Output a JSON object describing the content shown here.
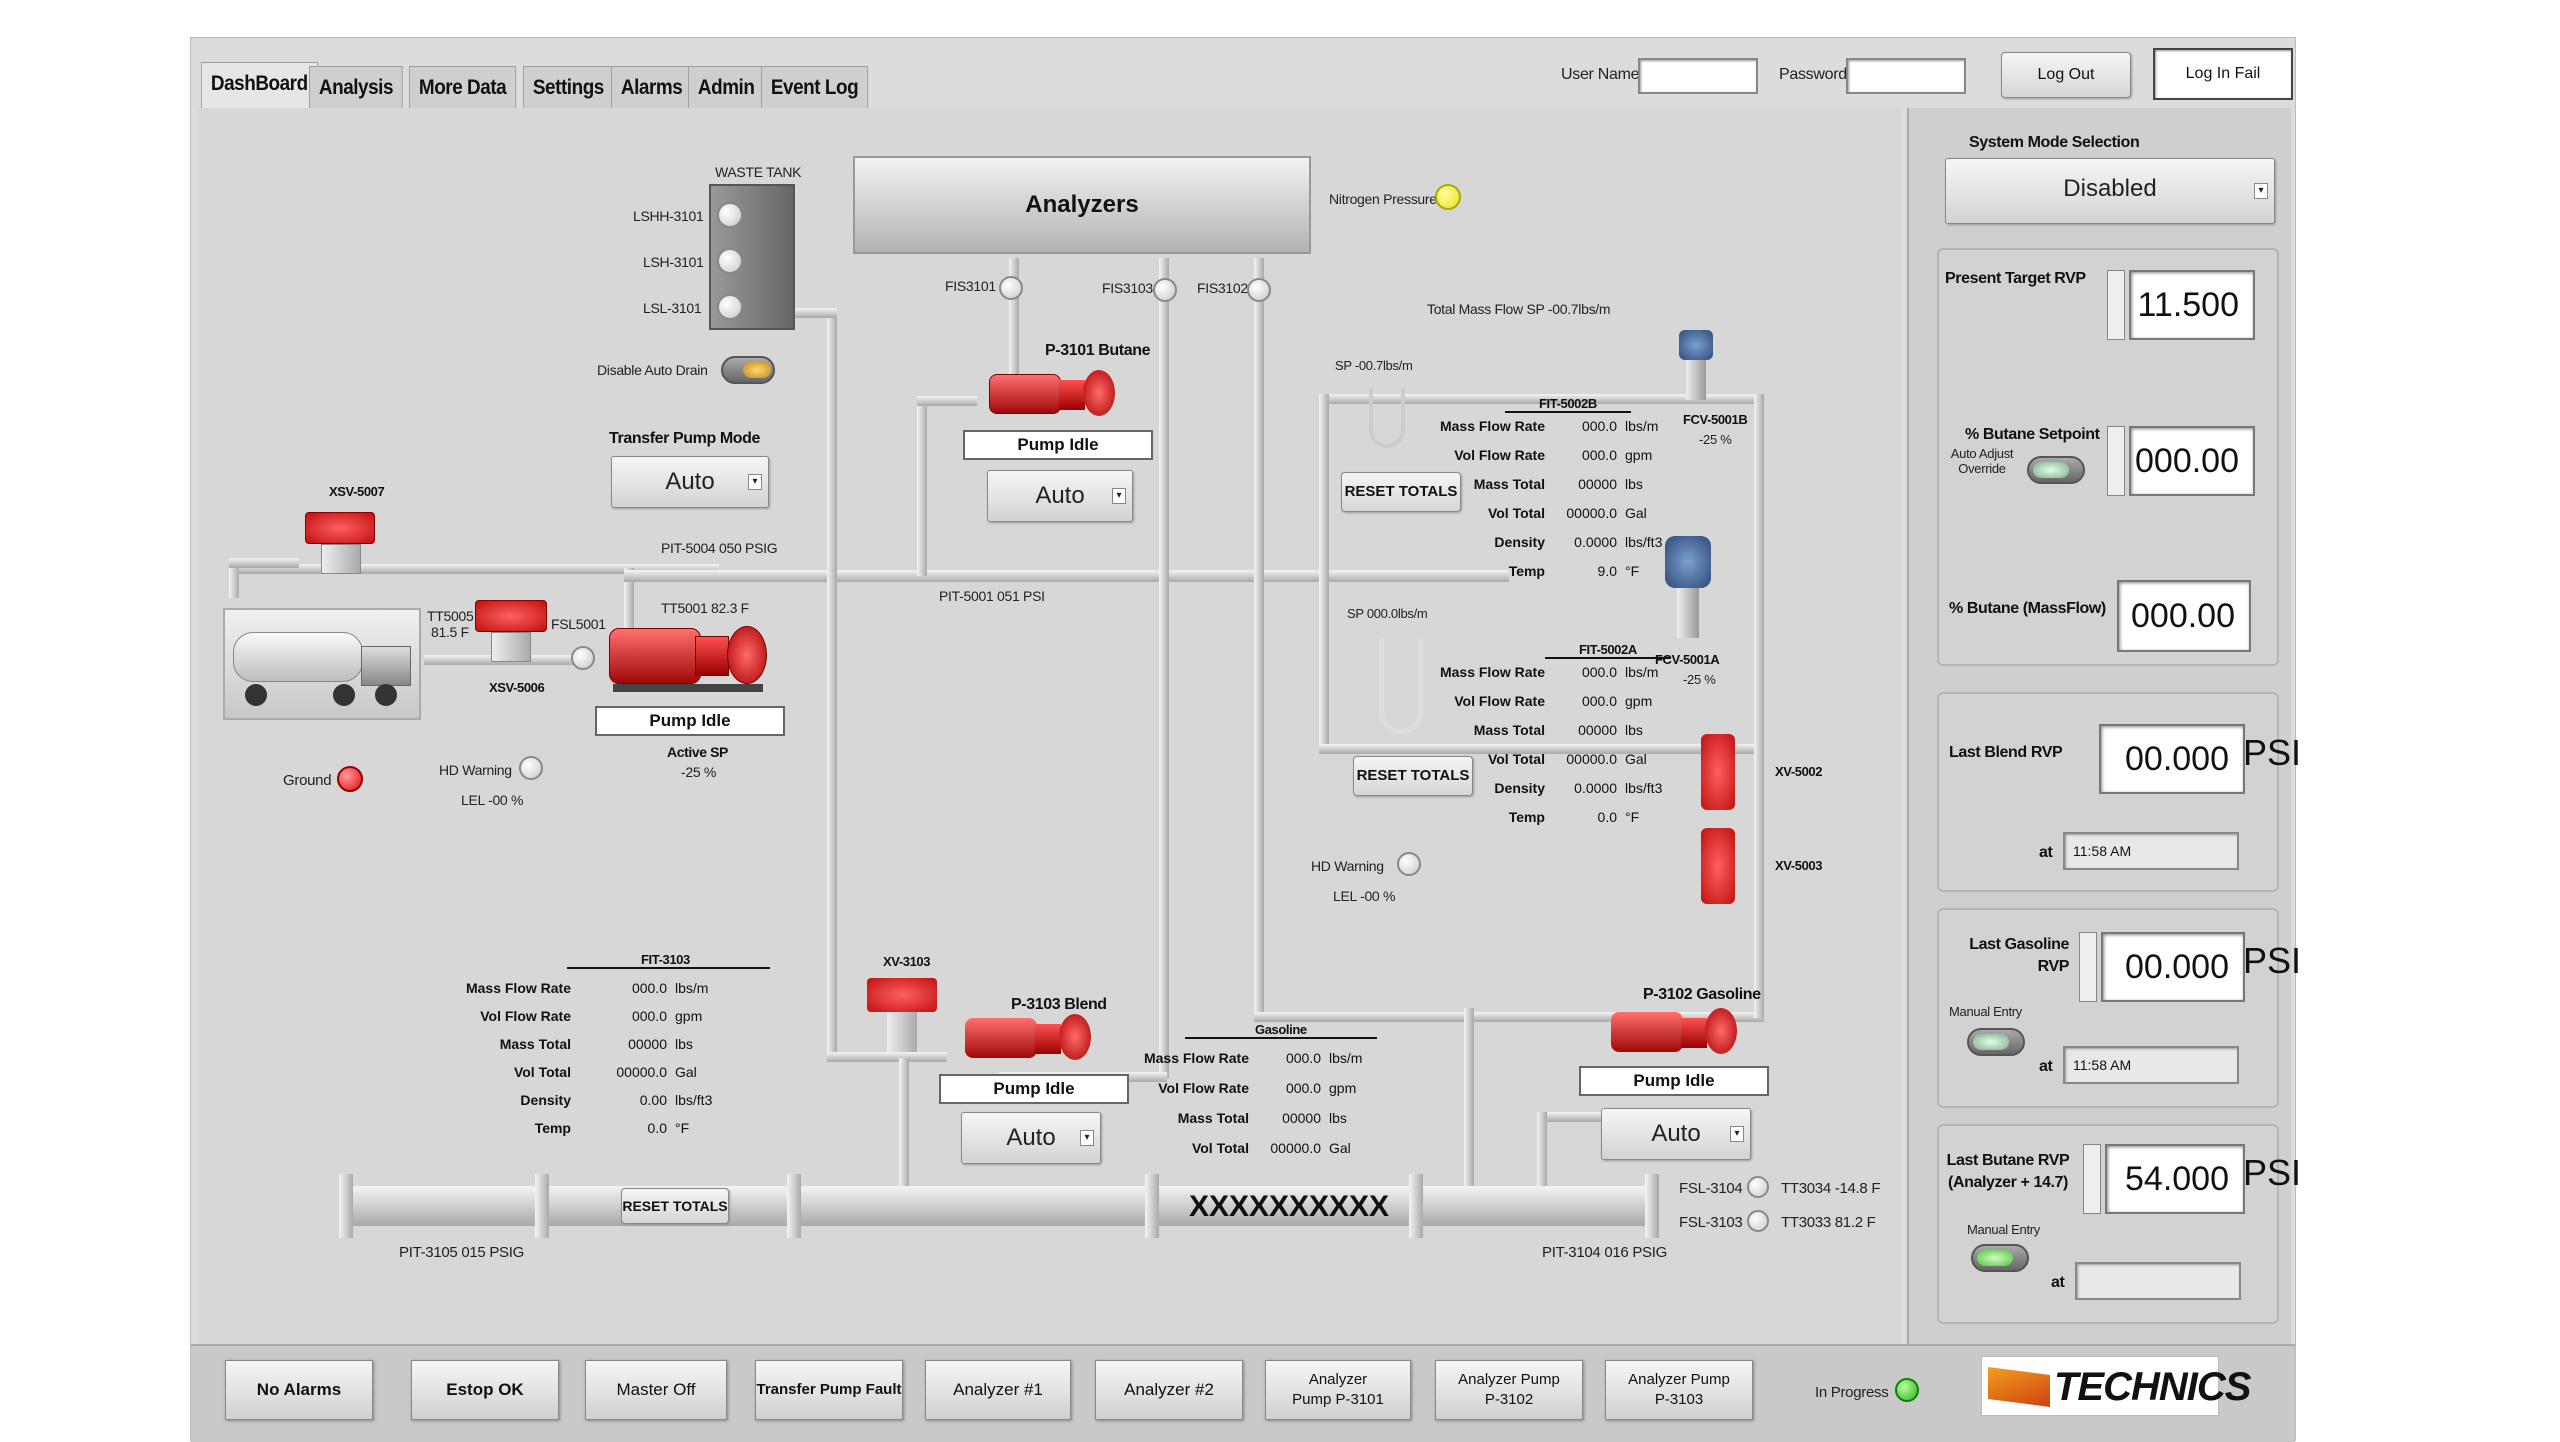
{
  "tabs": [
    "DashBoard",
    "Analysis",
    "More Data",
    "Settings",
    "Alarms",
    "Admin",
    "Event Log"
  ],
  "login": {
    "user_label": "User Name",
    "password_label": "Password",
    "logout_label": "Log Out",
    "status": "Log In Fail"
  },
  "waste_tank": {
    "title": "WASTE TANK",
    "levels": [
      "LSHH-3101",
      "LSH-3101",
      "LSL-3101"
    ],
    "drain_label": "Disable Auto Drain"
  },
  "analyzers": {
    "label": "Analyzers",
    "nitrogen_label": "Nitrogen Pressure",
    "fis": [
      "FIS3101",
      "FIS3103",
      "FIS3102"
    ]
  },
  "transfer": {
    "mode_label": "Transfer Pump Mode",
    "mode_value": "Auto",
    "xsv5007": "XSV-5007",
    "tt5005": "TT5005",
    "tt5005_val": "81.5 F",
    "fsl5001": "FSL5001",
    "xsv5006": "XSV-5006",
    "tt5001": "TT5001 82.3 F",
    "pit5004": "PIT-5004 050 PSIG",
    "pump_status": "Pump Idle",
    "active_sp": "Active SP",
    "active_sp_val": "-25 %",
    "hd_warning": "HD Warning",
    "lel": "LEL -00 %",
    "ground": "Ground"
  },
  "p3101": {
    "title": "P-3101 Butane",
    "status": "Pump Idle",
    "mode": "Auto"
  },
  "p3103": {
    "title": "P-3103 Blend",
    "status": "Pump Idle",
    "mode": "Auto",
    "xv": "XV-3103"
  },
  "p3102": {
    "title": "P-3102 Gasoline",
    "status": "Pump Idle",
    "mode": "Auto"
  },
  "pit5001": "PIT-5001 051 PSI",
  "total_mass_sp": "Total Mass Flow SP -00.7lbs/m",
  "fit5002b": {
    "sp": "SP -00.7lbs/m",
    "title": "FIT-5002B",
    "rows": [
      [
        "Mass Flow Rate",
        "000.0",
        "lbs/m"
      ],
      [
        "Vol Flow Rate",
        "000.0",
        "gpm"
      ],
      [
        "Mass Total",
        "00000",
        "lbs"
      ],
      [
        "Vol Total",
        "00000.0",
        "Gal"
      ],
      [
        "Density",
        "0.0000",
        "lbs/ft3"
      ],
      [
        "Temp",
        "9.0",
        "°F"
      ]
    ],
    "reset": "RESET TOTALS",
    "fcv": "FCV-5001B",
    "fcv_val": "-25 %"
  },
  "fit5002a": {
    "sp": "SP 000.0lbs/m",
    "title": "FIT-5002A",
    "rows": [
      [
        "Mass Flow Rate",
        "000.0",
        "lbs/m"
      ],
      [
        "Vol Flow Rate",
        "000.0",
        "gpm"
      ],
      [
        "Mass Total",
        "00000",
        "lbs"
      ],
      [
        "Vol Total",
        "00000.0",
        "Gal"
      ],
      [
        "Density",
        "0.0000",
        "lbs/ft3"
      ],
      [
        "Temp",
        "0.0",
        "°F"
      ]
    ],
    "reset": "RESET TOTALS",
    "fcv": "FCV-5001A",
    "fcv_val": "-25 %",
    "hd_warning": "HD Warning",
    "lel": "LEL -00 %",
    "xv5002": "XV-5002",
    "xv5003": "XV-5003"
  },
  "fit3103": {
    "title": "FIT-3103",
    "rows": [
      [
        "Mass Flow Rate",
        "000.0",
        "lbs/m"
      ],
      [
        "Vol Flow Rate",
        "000.0",
        "gpm"
      ],
      [
        "Mass Total",
        "00000",
        "lbs"
      ],
      [
        "Vol Total",
        "00000.0",
        "Gal"
      ],
      [
        "Density",
        "0.00",
        "lbs/ft3"
      ],
      [
        "Temp",
        "0.0",
        "°F"
      ]
    ],
    "reset": "RESET TOTALS"
  },
  "gasoline": {
    "title": "Gasoline",
    "rows": [
      [
        "Mass Flow Rate",
        "000.0",
        "lbs/m"
      ],
      [
        "Vol Flow Rate",
        "000.0",
        "gpm"
      ],
      [
        "Mass Total",
        "00000",
        "lbs"
      ],
      [
        "Vol Total",
        "00000.0",
        "Gal"
      ]
    ]
  },
  "header_pipe": {
    "label": "XXXXXXXXXX",
    "pit3105": "PIT-3105 015 PSIG",
    "pit3104": "PIT-3104 016 PSIG",
    "fsl3104": "FSL-3104",
    "fsl3103": "FSL-3103",
    "tt3034": "TT3034 -14.8 F",
    "tt3033": "TT3033 81.2 F"
  },
  "right": {
    "mode_title": "System Mode Selection",
    "mode_value": "Disabled",
    "target_rvp_label": "Present Target RVP",
    "target_rvp": "11.500",
    "butane_sp_label": "% Butane Setpoint",
    "auto_adjust": "Auto Adjust Override",
    "butane_sp": "000.00",
    "butane_mass_label": "% Butane (MassFlow)",
    "butane_mass": "000.00",
    "last_blend_label": "Last Blend RVP",
    "last_blend": "00.000",
    "last_blend_unit": "PSI",
    "at": "at",
    "last_blend_at": "11:58 AM",
    "last_gas_label": "Last Gasoline RVP",
    "last_gas": "00.000",
    "last_gas_unit": "PSI",
    "manual_entry": "Manual Entry",
    "last_gas_at": "11:58 AM",
    "last_butane_label": "Last Butane RVP (Analyzer + 14.7)",
    "last_butane": "54.000",
    "last_butane_unit": "PSI",
    "last_butane_at": ""
  },
  "bottom": [
    "No Alarms",
    "Estop OK",
    "Master Off",
    "Transfer Pump Fault",
    "Analyzer #1",
    "Analyzer #2",
    "Analyzer Pump P-3101",
    "Analyzer Pump P-3102",
    "Analyzer Pump P-3103"
  ],
  "in_progress": "In Progress",
  "logo": "TECHNICS",
  "colors": {
    "pump": "#d41a1a",
    "led_red": "#e01010",
    "led_yellow": "#e8e020",
    "led_green": "#30b020"
  }
}
